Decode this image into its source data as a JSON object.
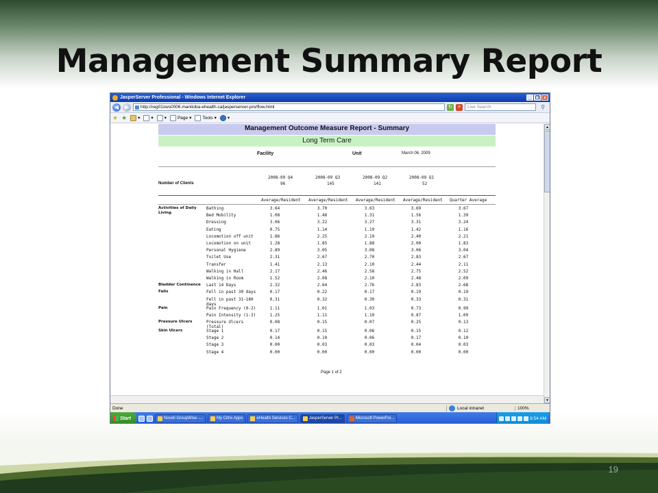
{
  "slide": {
    "title": "Management Summary Report",
    "page_number": "19"
  },
  "browser": {
    "window_title": "JasperServer Professional - Windows Internet Explorer",
    "url": "http://reg01xws0006.manitoba-ehealth.ca/jasperserver-pro/flow.html",
    "search_placeholder": "Live Search",
    "toolbar": {
      "page_label": "Page",
      "tools_label": "Tools"
    },
    "status_text": "Done",
    "zone_text": "Local intranet",
    "zoom_text": "100%"
  },
  "report": {
    "title": "Management Outcome Measure Report - Summary",
    "subtitle": "Long Term Care",
    "facility_label": "Facility",
    "unit_label": "Unit",
    "date": "March 06, 2009",
    "quarters": [
      "2008-09 Q4",
      "2008-09 Q3",
      "2008-09 Q2",
      "2008-09 Q1"
    ],
    "clients_label": "Number of Clients",
    "clients": [
      "96",
      "145",
      "141",
      "52"
    ],
    "column_headers": [
      "Average/Resident",
      "Average/Resident",
      "Average/Resident",
      "Average/Resident",
      "Quarter Average"
    ],
    "rows": [
      {
        "category": "Activities of Daily Living",
        "item": "Bathing",
        "values": [
          "3.64",
          "3.70",
          "3.63",
          "3.69",
          "3.67"
        ]
      },
      {
        "category": "",
        "item": "Bed Mobility",
        "values": [
          "1.08",
          "1.48",
          "1.31",
          "1.56",
          "1.39"
        ]
      },
      {
        "category": "",
        "item": "Dressing",
        "values": [
          "3.06",
          "3.22",
          "3.27",
          "3.31",
          "3.24"
        ]
      },
      {
        "category": "",
        "item": "Eating",
        "values": [
          "0.75",
          "1.14",
          "1.19",
          "1.42",
          "1.16"
        ]
      },
      {
        "category": "",
        "item": "Locomotion off unit",
        "values": [
          "1.86",
          "2.25",
          "2.19",
          "2.40",
          "2.21"
        ]
      },
      {
        "category": "",
        "item": "Locomotion on unit",
        "values": [
          "1.28",
          "1.85",
          "1.88",
          "2.00",
          "1.83"
        ]
      },
      {
        "category": "",
        "item": "Personal Hygiene",
        "values": [
          "2.89",
          "3.05",
          "3.08",
          "3.06",
          "3.04"
        ]
      },
      {
        "category": "",
        "item": "Toilet Use",
        "values": [
          "2.31",
          "2.67",
          "2.70",
          "2.83",
          "2.67"
        ]
      },
      {
        "category": "",
        "item": "Transfer",
        "values": [
          "1.41",
          "2.13",
          "2.10",
          "2.44",
          "2.11"
        ]
      },
      {
        "category": "",
        "item": "Walking in Hall",
        "values": [
          "2.17",
          "2.46",
          "2.58",
          "2.75",
          "2.52"
        ]
      },
      {
        "category": "",
        "item": "Walking in Room",
        "values": [
          "1.52",
          "2.08",
          "2.10",
          "2.48",
          "2.09"
        ]
      },
      {
        "category": "Bladder Continence",
        "item": "Last 14 Days",
        "values": [
          "2.32",
          "2.64",
          "2.76",
          "2.83",
          "2.68"
        ]
      },
      {
        "category": "Falls",
        "item": "Fell in past 30 days",
        "values": [
          "0.17",
          "0.22",
          "0.17",
          "0.19",
          "0.19"
        ]
      },
      {
        "category": "",
        "item": "Fell in past 31-180 days",
        "values": [
          "0.31",
          "0.32",
          "0.30",
          "0.33",
          "0.31"
        ]
      },
      {
        "category": "Pain",
        "item": "Pain Frequency (0-2)",
        "values": [
          "1.11",
          "1.01",
          "1.03",
          "0.73",
          "0.99"
        ]
      },
      {
        "category": "",
        "item": "Pain Intensity (1-3)",
        "values": [
          "1.25",
          "1.11",
          "1.10",
          "0.87",
          "1.09"
        ]
      },
      {
        "category": "Pressure Ulcers",
        "item": "Pressure Ulcers (Total)",
        "values": [
          "0.08",
          "0.15",
          "0.07",
          "0.25",
          "0.13"
        ]
      },
      {
        "category": "Skin Ulcers",
        "item": "Stage 1",
        "values": [
          "0.17",
          "0.15",
          "0.06",
          "0.15",
          "0.12"
        ]
      },
      {
        "category": "",
        "item": "Stage 2",
        "values": [
          "0.14",
          "0.10",
          "0.06",
          "0.17",
          "0.10"
        ]
      },
      {
        "category": "",
        "item": "Stage 3",
        "values": [
          "0.00",
          "0.03",
          "0.03",
          "0.04",
          "0.03"
        ]
      },
      {
        "category": "",
        "item": "Stage 4",
        "values": [
          "0.00",
          "0.00",
          "0.00",
          "0.00",
          "0.00"
        ]
      }
    ],
    "page_label": "Page 1 of 2"
  },
  "taskbar": {
    "start_label": "Start",
    "tasks": [
      "Novell GroupWise -...",
      "My Citrix Apps",
      "eHealth Services C...",
      "JasperServer Pr...",
      "Microsoft PowerPoi..."
    ],
    "clock": "8:54 AM"
  },
  "colors": {
    "title_band": "#c9caef",
    "subtitle_band": "#c8f2c4",
    "taskbar_blue": "#245ad6",
    "titlebar_blue": "#0a3ba8"
  }
}
